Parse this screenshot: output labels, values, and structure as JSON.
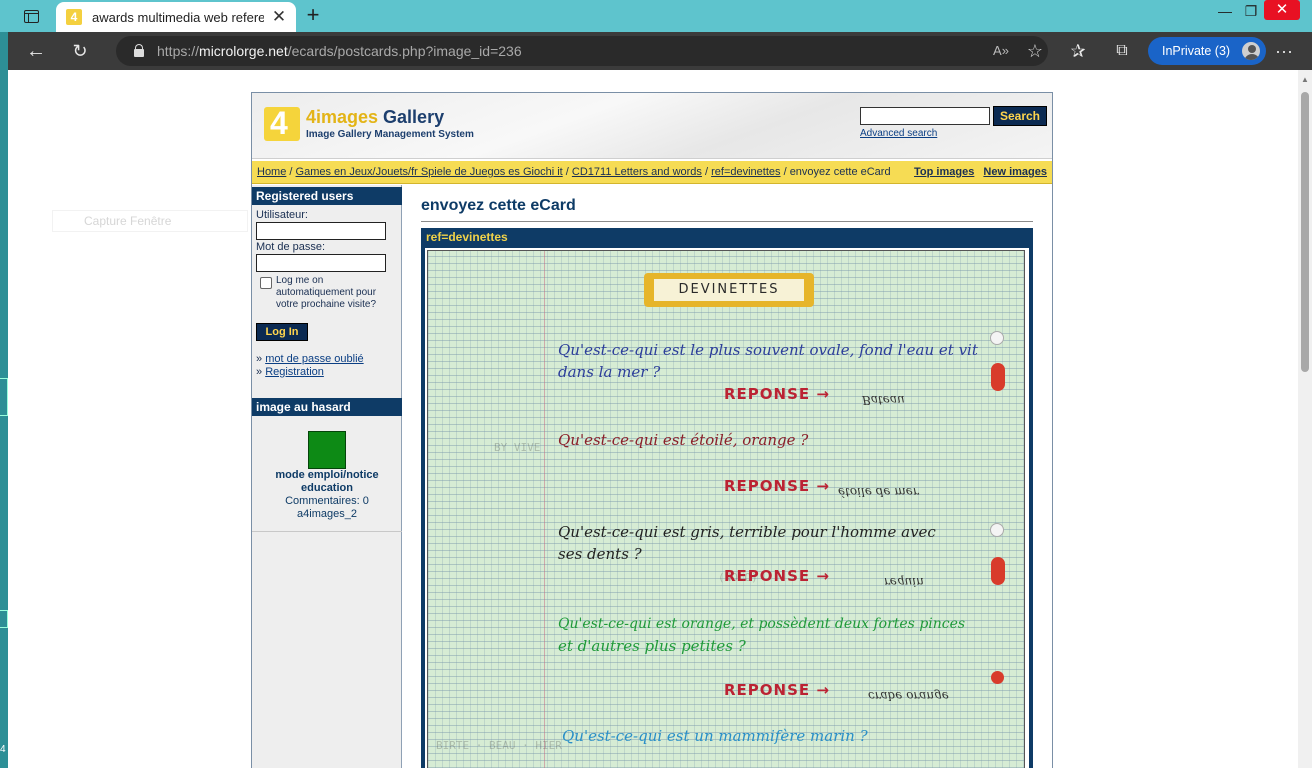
{
  "browser": {
    "tab_title": "awards multimedia web reference",
    "tab_close": "✕",
    "new_tab": "+",
    "url_prefix": "https://",
    "url_host": "microlorge.net",
    "url_path": "/ecards/postcards.php?image_id=236",
    "inprivate_label": "InPrivate (3)",
    "window": {
      "minimize": "—",
      "maximize": "❐",
      "close": "✕"
    }
  },
  "desktop": {
    "ghost_label": "Capture Fenêtre",
    "left_number": "4"
  },
  "site": {
    "logo_title_num": "4images",
    "logo_title_rest": " Gallery",
    "logo_subtitle": "Image Gallery Management System",
    "search_button": "Search",
    "advanced_search": "Advanced search"
  },
  "breadcrumb": {
    "items": [
      "Home",
      "Games en Jeux/Jouets/fr Spiele de Juegos es Giochi it",
      "CD1711 Letters and words",
      "ref=devinettes"
    ],
    "current": "envoyez cette eCard",
    "sep": " / ",
    "top_images": "Top images",
    "new_images": "New images"
  },
  "sidebar": {
    "registered_users": "Registered users",
    "username_label": "Utilisateur:",
    "password_label": "Mot de passe:",
    "remember_me": "Log me on automatiquement pour votre prochaine visite?",
    "login_button": "Log In",
    "link_bullet": "» ",
    "forgot_password": "mot de passe oublié",
    "registration": "Registration",
    "random_image_heading": "image au hasard",
    "random_image_title": "mode emploi/notice education",
    "random_image_comments": "Commentaires: 0",
    "random_image_user": "a4images_2"
  },
  "main": {
    "heading": "envoyez cette eCard",
    "image_title": "ref=devinettes",
    "notebook": {
      "banner": "DEVINETTES",
      "reponse": "REPONSE →",
      "questions": [
        {
          "line1": "Qu'est-ce-qui est le plus souvent ovale, fond l'eau et vit",
          "line2": "dans la mer ?",
          "color": "#2c3e9a",
          "answer": "Bateau"
        },
        {
          "line1": "Qu'est-ce-qui est étoilé, orange ?",
          "line2": "",
          "color": "#8a1f2a",
          "answer": "étoile de mer"
        },
        {
          "line1": "Qu'est-ce-qui est gris, terrible pour l'homme avec",
          "line2": "ses dents ?",
          "color": "#222222",
          "answer": "requin"
        },
        {
          "line1": "Qu'est-ce-qui est orange, et possèdent deux fortes pinces",
          "line2": "et d'autres plus petites ?",
          "color": "#1f9a3a",
          "answer": "crabe orange"
        },
        {
          "line1": "Qu'est-ce-qui est un mammifère marin ?",
          "line2": "",
          "color": "#2a8fc8",
          "answer": ""
        }
      ]
    }
  }
}
